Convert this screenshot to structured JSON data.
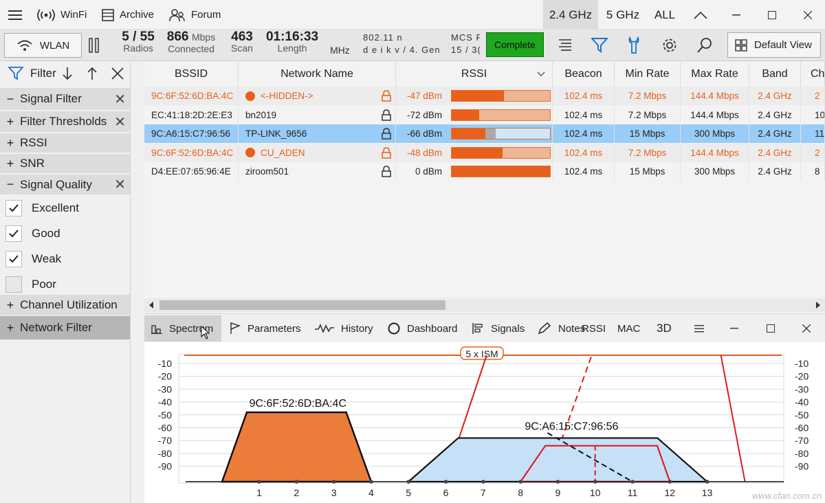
{
  "titlebar": {
    "app_name": "WinFi",
    "archive": "Archive",
    "forum": "Forum",
    "band_24": "2.4 GHz",
    "band_5": "5 GHz",
    "band_all": "ALL"
  },
  "toolbar": {
    "wlan": "WLAN",
    "radios_value": "5 / 55",
    "radios_label": "Radios",
    "connected_value": "866",
    "connected_unit": "Mbps",
    "connected_label": "Connected",
    "scan_value": "463",
    "scan_label": "Scan",
    "length_value": "01:16:33",
    "length_label": "Length",
    "mhz_label": "MHz",
    "standard_line1": "802.11 n",
    "standard_line2": "d e i k v / 4. Gen",
    "mcs_line1": "MCS F",
    "mcs_line2": "15 / 3(",
    "complete": "Complete",
    "default_view": "Default View"
  },
  "sidebar": {
    "filter_label": "Filter",
    "signal_filter": "Signal Filter",
    "filter_thresholds": "Filter Thresholds",
    "rssi": "RSSI",
    "snr": "SNR",
    "signal_quality": "Signal Quality",
    "quality_items": [
      {
        "label": "Excellent",
        "checked": true
      },
      {
        "label": "Good",
        "checked": true
      },
      {
        "label": "Weak",
        "checked": true
      },
      {
        "label": "Poor",
        "checked": false
      }
    ],
    "channel_utilization": "Channel Utilization",
    "network_filter": "Network Filter"
  },
  "table": {
    "columns": [
      "BSSID",
      "Network Name",
      "RSSI",
      "Beacon",
      "Min Rate",
      "Max Rate",
      "Band",
      "Ch"
    ],
    "rows": [
      {
        "bssid": "9C:6F:52:6D:BA:4C",
        "name": "<-HIDDEN->",
        "rssi": "-47 dBm",
        "rssi_fill": 0.53,
        "beacon": "102.4 ms",
        "min_rate": "7.2 Mbps",
        "max_rate": "144.4 Mbps",
        "band": "2.4 GHz",
        "ch": "2",
        "style": "orange"
      },
      {
        "bssid": "EC:41:18:2D:2E:E3",
        "name": "bn2019",
        "rssi": "-72 dBm",
        "rssi_fill": 0.28,
        "beacon": "102.4 ms",
        "min_rate": "7.2 Mbps",
        "max_rate": "144.4 Mbps",
        "band": "2.4 GHz",
        "ch": "10",
        "style": "normal"
      },
      {
        "bssid": "9C:A6:15:C7:96:56",
        "name": "TP-LINK_9656",
        "rssi": "-66 dBm",
        "rssi_fill": 0.34,
        "beacon": "102.4 ms",
        "min_rate": "15 Mbps",
        "max_rate": "300 Mbps",
        "band": "2.4 GHz",
        "ch": "11",
        "style": "selected"
      },
      {
        "bssid": "9C:6F:52:6D:BA:4C",
        "name": "CU_ADEN",
        "rssi": "-48 dBm",
        "rssi_fill": 0.52,
        "beacon": "102.4 ms",
        "min_rate": "7.2 Mbps",
        "max_rate": "144.4 Mbps",
        "band": "2.4 GHz",
        "ch": "2",
        "style": "orange"
      },
      {
        "bssid": "D4:EE:07:65:96:4E",
        "name": "ziroom501",
        "rssi": "0 dBm",
        "rssi_fill": 1.0,
        "beacon": "102.4 ms",
        "min_rate": "15 Mbps",
        "max_rate": "300 Mbps",
        "band": "2.4 GHz",
        "ch": "8",
        "style": "normal"
      }
    ]
  },
  "tabs": {
    "spectrum": "Spectrum",
    "parameters": "Parameters",
    "history": "History",
    "dashboard": "Dashboard",
    "signals": "Signals",
    "notes": "Notes",
    "rssi": "RSSI",
    "mac": "MAC",
    "three_d": "3D"
  },
  "spectrum": {
    "ism_label": "5 x ISM",
    "y_ticks": [
      "-10",
      "-20",
      "-30",
      "-40",
      "-50",
      "-60",
      "-70",
      "-80",
      "-90"
    ],
    "x_ticks": [
      "1",
      "2",
      "3",
      "4",
      "5",
      "6",
      "7",
      "8",
      "9",
      "10",
      "11",
      "12",
      "13"
    ],
    "label_a": "9C:6F:52:6D:BA:4C",
    "label_b": "9C:A6:15:C7:96:56",
    "watermark": "www.cfan.com.cn"
  },
  "colors": {
    "orange": "#e8601c",
    "selected_row": "#99ccf7",
    "complete_green": "#1fa81f",
    "accent_blue": "#1e6fd9"
  }
}
